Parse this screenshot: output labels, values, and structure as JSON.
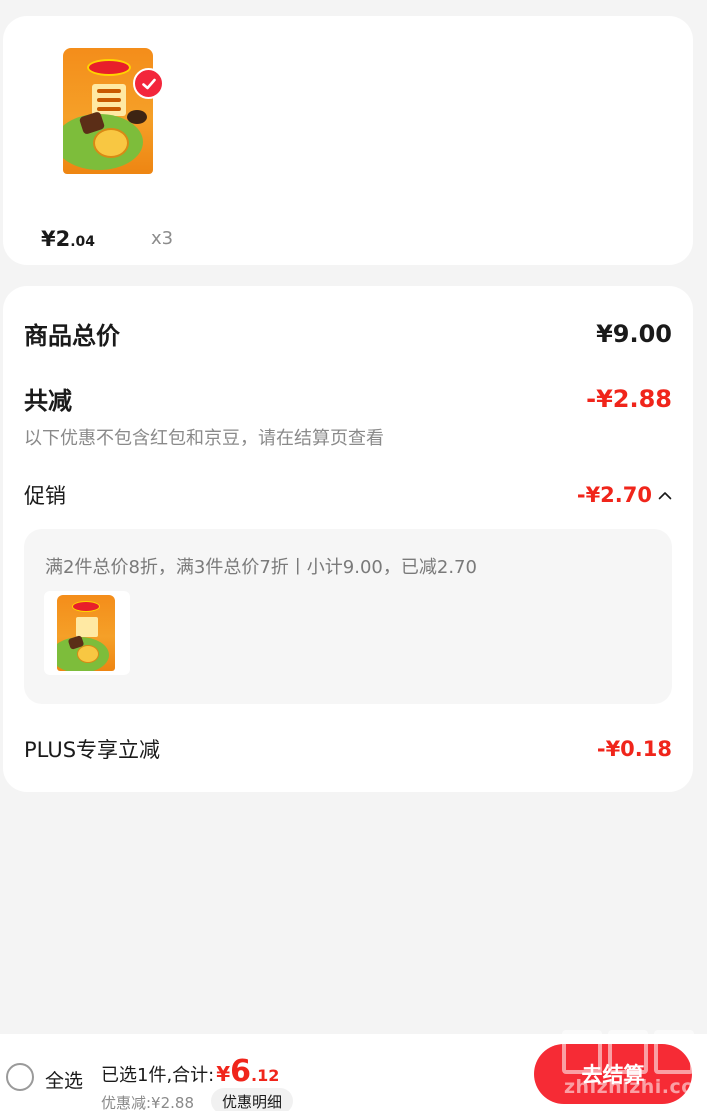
{
  "product": {
    "price_int": "¥2",
    "price_dec": ".04",
    "quantity": "x3"
  },
  "summary": {
    "total_label": "商品总价",
    "total_value": "¥9.00",
    "reduce_label": "共减",
    "reduce_value": "-¥2.88",
    "note": "以下优惠不包含红包和京豆，请在结算页查看",
    "promo_label": "促销",
    "promo_value": "-¥2.70",
    "promo_detail": "满2件总价8折，满3件总价7折丨小计9.00，已减2.70",
    "plus_label": "PLUS专享立减",
    "plus_value": "-¥0.18"
  },
  "bottom_bar": {
    "select_all": "全选",
    "selected_prefix": "已选1件,合计:",
    "total_currency": "¥",
    "total_int": "6",
    "total_dec": ".12",
    "discount": "优惠减:¥2.88",
    "detail_button": "优惠明细",
    "checkout_button": "去结算"
  },
  "watermark": {
    "url": "zhizhizhi.com"
  },
  "colors": {
    "accent": "#f0251b",
    "checkout": "#f62b35"
  },
  "icons": {
    "selected": "check-badge-icon",
    "collapse": "chevron-up-icon",
    "select_all": "radio-circle-icon"
  }
}
